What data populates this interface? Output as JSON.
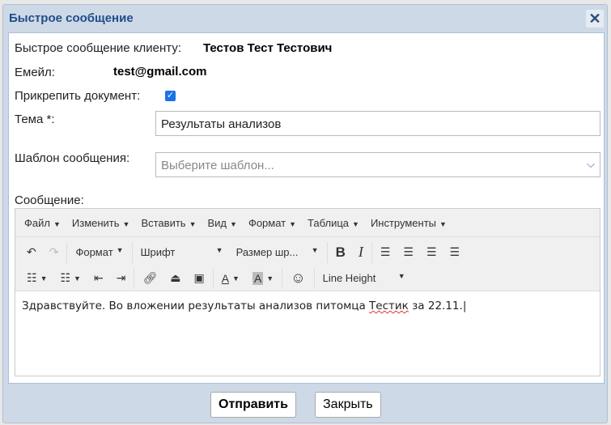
{
  "dialog": {
    "title": "Быстрое сообщение",
    "close": "✕"
  },
  "form": {
    "client_label": "Быстрое сообщение клиенту:",
    "client_value": "Тестов Тест Тестович",
    "email_label": "Емейл:",
    "email_value": "test@gmail.com",
    "attach_label": "Прикрепить документ:",
    "attach_checked": true,
    "subject_label": "Тема *:",
    "subject_value": "Результаты анализов",
    "template_label": "Шаблон сообщения:",
    "template_placeholder": "Выберите шаблон...",
    "message_label": "Сообщение:"
  },
  "editor": {
    "menu": [
      "Файл",
      "Изменить",
      "Вставить",
      "Вид",
      "Формат",
      "Таблица",
      "Инструменты"
    ],
    "format": "Формат",
    "font": "Шрифт",
    "size": "Размер шр...",
    "line_height": "Line Height",
    "content_before": "Здравствуйте. Во вложении результаты анализов питомца ",
    "content_misspelled": "Тестик",
    "content_after": " за 22.11."
  },
  "buttons": {
    "send": "Отправить",
    "close": "Закрыть"
  }
}
